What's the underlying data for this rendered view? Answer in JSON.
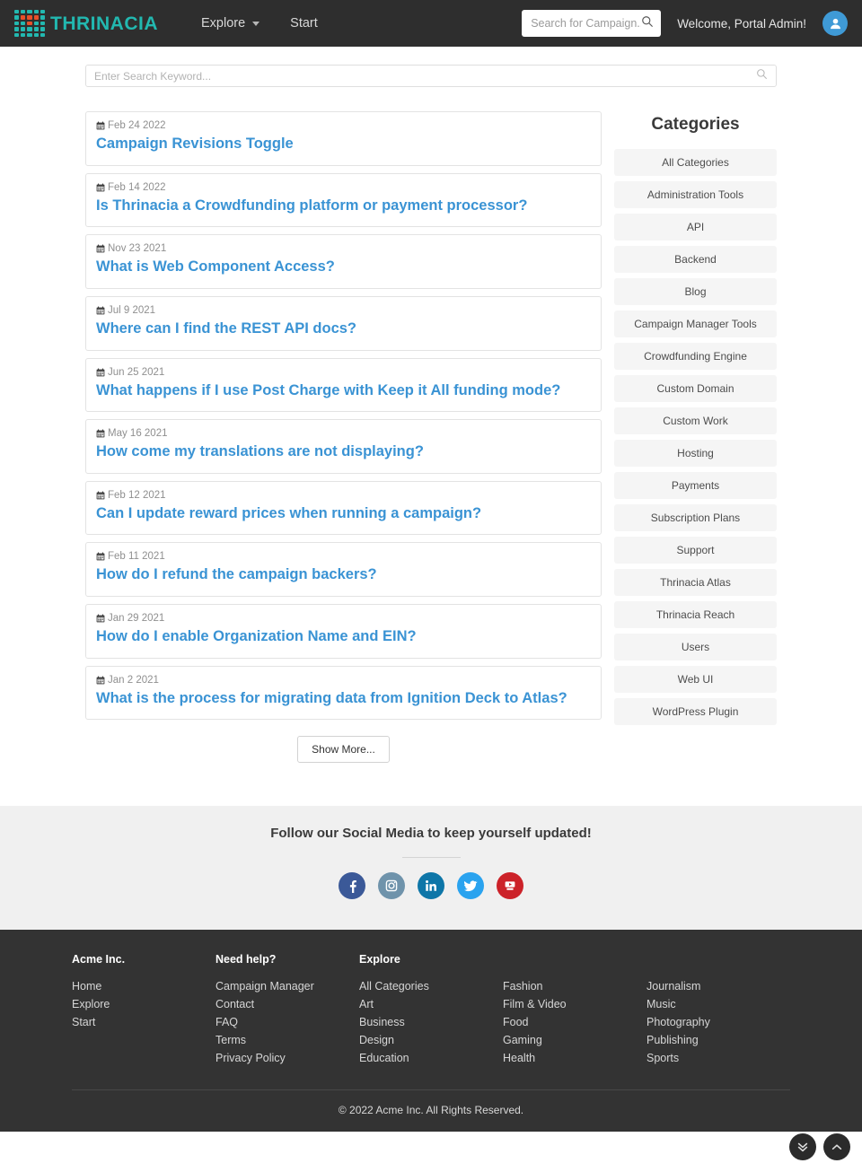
{
  "header": {
    "brand": "THRINACIA",
    "logo_colors": {
      "primary": "#22b8b0",
      "accent": "#e8502a"
    },
    "nav": [
      {
        "label": "Explore",
        "has_caret": true
      },
      {
        "label": "Start",
        "has_caret": false
      }
    ],
    "search": {
      "placeholder": "Search for Campaign...",
      "value": ""
    },
    "welcome": "Welcome, Portal Admin!",
    "avatar_icon": "user-icon"
  },
  "page_search": {
    "placeholder": "Enter Search Keyword...",
    "value": ""
  },
  "articles": [
    {
      "date": "Feb 24 2022",
      "title": "Campaign Revisions Toggle"
    },
    {
      "date": "Feb 14 2022",
      "title": "Is Thrinacia a Crowdfunding platform or payment processor?"
    },
    {
      "date": "Nov 23 2021",
      "title": "What is Web Component Access?"
    },
    {
      "date": "Jul 9 2021",
      "title": "Where can I find the REST API docs?"
    },
    {
      "date": "Jun 25 2021",
      "title": "What happens if I use Post Charge with Keep it All funding mode?"
    },
    {
      "date": "May 16 2021",
      "title": "How come my translations are not displaying?"
    },
    {
      "date": "Feb 12 2021",
      "title": "Can I update reward prices when running a campaign?"
    },
    {
      "date": "Feb 11 2021",
      "title": "How do I refund the campaign backers?"
    },
    {
      "date": "Jan 29 2021",
      "title": "How do I enable Organization Name and EIN?"
    },
    {
      "date": "Jan 2 2021",
      "title": "What is the process for migrating data from Ignition Deck to Atlas?"
    }
  ],
  "show_more_label": "Show More...",
  "sidebar": {
    "title": "Categories",
    "items": [
      "All Categories",
      "Administration Tools",
      "API",
      "Backend",
      "Blog",
      "Campaign Manager Tools",
      "Crowdfunding Engine",
      "Custom Domain",
      "Custom Work",
      "Hosting",
      "Payments",
      "Subscription Plans",
      "Support",
      "Thrinacia Atlas",
      "Thrinacia Reach",
      "Users",
      "Web UI",
      "WordPress Plugin"
    ]
  },
  "social": {
    "heading": "Follow our Social Media to keep yourself updated!",
    "icons": [
      {
        "name": "facebook-icon",
        "color": "#3b5998"
      },
      {
        "name": "instagram-icon",
        "color": "#6f93ab"
      },
      {
        "name": "linkedin-icon",
        "color": "#0e76a8"
      },
      {
        "name": "twitter-icon",
        "color": "#2aa3ef"
      },
      {
        "name": "youtube-icon",
        "color": "#cc2229"
      }
    ]
  },
  "footer": {
    "columns": [
      {
        "heading": "Acme Inc.",
        "links": [
          "Home",
          "Explore",
          "Start"
        ]
      },
      {
        "heading": "Need help?",
        "links": [
          "Campaign Manager",
          "Contact",
          "FAQ",
          "Terms",
          "Privacy Policy"
        ]
      },
      {
        "heading": "Explore",
        "links": [
          "All Categories",
          "Art",
          "Business",
          "Design",
          "Education"
        ]
      },
      {
        "heading": "",
        "links": [
          "Fashion",
          "Film & Video",
          "Food",
          "Gaming",
          "Health"
        ]
      },
      {
        "heading": "",
        "links": [
          "Journalism",
          "Music",
          "Photography",
          "Publishing",
          "Sports"
        ]
      }
    ],
    "copyright": "© 2022 Acme Inc. All Rights Reserved."
  },
  "fabs": [
    {
      "name": "chevron-double-down-icon"
    },
    {
      "name": "chevron-up-icon"
    }
  ]
}
